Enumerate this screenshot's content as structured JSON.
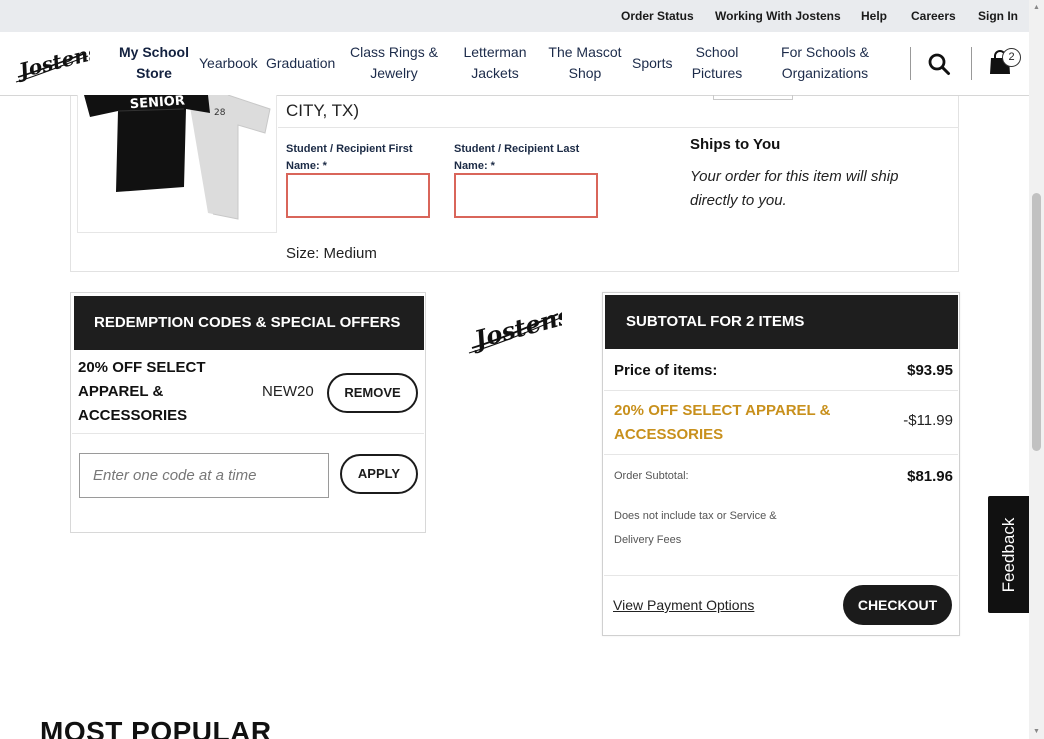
{
  "utility_nav": {
    "order_status": "Order Status",
    "working_with": "Working With Jostens",
    "help": "Help",
    "careers": "Careers",
    "sign_in": "Sign In"
  },
  "header": {
    "logo_text": "Jostens",
    "nav": [
      {
        "line1": "My School",
        "line2": "Store"
      },
      {
        "line1": "Yearbook",
        "line2": ""
      },
      {
        "line1": "Graduation",
        "line2": ""
      },
      {
        "line1": "Class Rings &",
        "line2": "Jewelry"
      },
      {
        "line1": "Letterman",
        "line2": "Jackets"
      },
      {
        "line1": "The Mascot",
        "line2": "Shop"
      },
      {
        "line1": "Sports",
        "line2": ""
      },
      {
        "line1": "School",
        "line2": "Pictures"
      },
      {
        "line1": "For Schools &",
        "line2": "Organizations"
      }
    ],
    "cart_count": "2"
  },
  "product": {
    "location_tail": "CITY, TX)",
    "image_shirt_text": "SENIOR",
    "image_number": "28",
    "first_name_label": "Student / Recipient First Name: *",
    "last_name_label": "Student / Recipient Last Name: *",
    "first_name_value": "",
    "last_name_value": "",
    "ships_title": "Ships to You",
    "ships_text": "Your order for this item will ship directly to you.",
    "size": "Size: Medium"
  },
  "redemption": {
    "title": "REDEMPTION CODES & SPECIAL OFFERS",
    "offer_name": "20% OFF SELECT APPAREL & ACCESSORIES",
    "offer_code": "NEW20",
    "remove_label": "REMOVE",
    "code_placeholder": "Enter one code at a time",
    "code_value": "",
    "apply_label": "APPLY"
  },
  "subtotal": {
    "title": "SUBTOTAL FOR 2 ITEMS",
    "price_label": "Price of items:",
    "price_value": "$93.95",
    "discount_label": "20% OFF SELECT APPAREL & ACCESSORIES",
    "discount_value": "-$11.99",
    "order_subtotal_label": "Order Subtotal:",
    "order_subtotal_value": "$81.96",
    "disclaimer": "Does not include tax or Service & Delivery Fees",
    "payment_options": "View Payment Options",
    "checkout_label": "CHECKOUT"
  },
  "most_popular": "MOST POPULAR",
  "feedback_label": "Feedback",
  "colors": {
    "header_bar": "#1e1e1e",
    "discount_gold": "#c8901c",
    "input_error_border": "#d9655a",
    "utility_bg": "#e9ebee"
  },
  "icons": [
    "search-icon",
    "shopping-bag-icon",
    "jostens-logo"
  ]
}
